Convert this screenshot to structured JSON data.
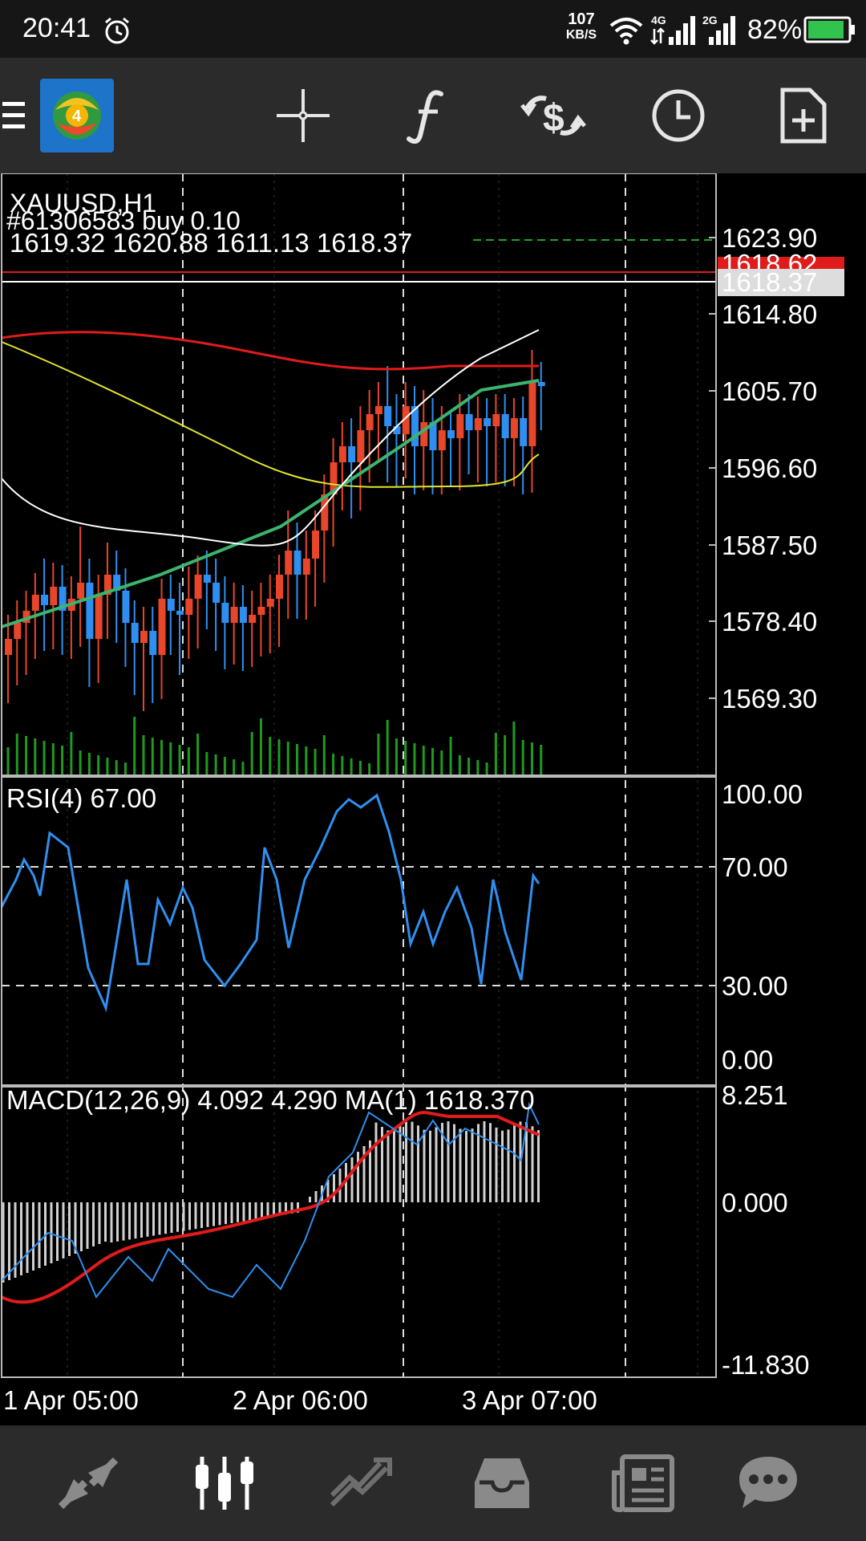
{
  "status": {
    "time": "20:41",
    "net_speed_value": "107",
    "net_speed_unit": "KB/S",
    "net1": "4G",
    "net2": "2G",
    "battery": "82%"
  },
  "toolbar": {
    "icons": [
      "menu-icon",
      "mt4-app-icon",
      "crosshair-icon",
      "indicators-icon",
      "trade-icon",
      "period-icon",
      "new-order-icon"
    ]
  },
  "chart": {
    "symbol": "XAUUSD,H1",
    "order_line": "#61306583 buy  0.10",
    "ohlc": "1619.32 1620.88 1611.13 1618.37",
    "price_ticks": [
      "1623.90",
      "1614.80",
      "1605.70",
      "1596.60",
      "1587.50",
      "1578.40",
      "1569.30"
    ],
    "ask_label": "1618.62",
    "bid_label": "1618.37",
    "rsi_label": "RSI(4) 67.00",
    "rsi_ticks": [
      "100.00",
      "70.00",
      "30.00",
      "0.00"
    ],
    "macd_label": "MACD(12,26,9) 4.092 4.290 MA(1) 1618.370",
    "macd_ticks": [
      "8.251",
      "0.000",
      "-11.830"
    ],
    "time_labels": [
      "1 Apr 05:00",
      "2 Apr 06:00",
      "3 Apr 07:00"
    ]
  },
  "colors": {
    "bull": "#e8462a",
    "bear": "#2f8ff0",
    "ma_red": "#e01b1b",
    "ma_yellow": "#e5e52d",
    "ma_green": "#3cb46e",
    "ma_white": "#ffffff",
    "volume": "#1f9a1f",
    "rsi_line": "#2f8ff0",
    "macd_hist": "#d0d0d0",
    "macd_signal": "#e01b1b",
    "toolbar_bg": "#2b2b2b"
  },
  "bottom_nav": [
    "quotes-icon",
    "chart-icon",
    "trade-icon",
    "history-icon",
    "news-icon",
    "chat-icon"
  ]
}
